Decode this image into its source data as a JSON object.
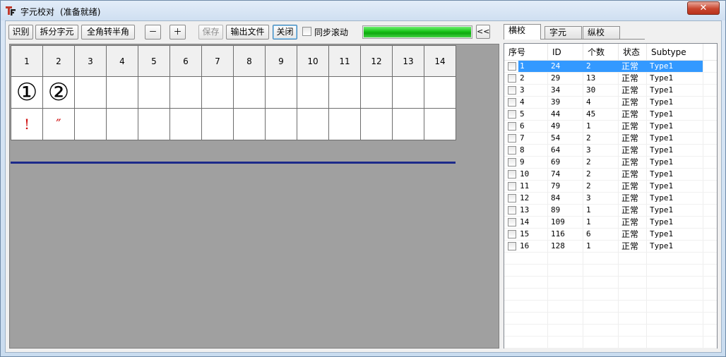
{
  "window": {
    "title": "字元校对",
    "status": "(准备就绪)",
    "close_label": "✕",
    "app_icon": "tf-logo-icon"
  },
  "toolbar": {
    "recognize": "识别",
    "split": "拆分字元",
    "fullwidth_to_halfwidth": "全角转半角",
    "zoom_out": "－",
    "zoom_in": "＋",
    "save": "保存",
    "export": "输出文件",
    "close": "关闭",
    "sync_scroll_label": "同步滚动",
    "sync_scroll_checked": false,
    "progress_percent": 100,
    "progress_color": "#17c217",
    "collapse": "<<"
  },
  "grid": {
    "columns": [
      "1",
      "2",
      "3",
      "4",
      "5",
      "6",
      "7",
      "8",
      "9",
      "10",
      "11",
      "12",
      "13",
      "14"
    ],
    "glyph_row": [
      "①",
      "②",
      "",
      "",
      "",
      "",
      "",
      "",
      "",
      "",
      "",
      "",
      "",
      ""
    ],
    "char_row": [
      "!",
      "″",
      "",
      "",
      "",
      "",
      "",
      "",
      "",
      "",
      "",
      "",
      "",
      ""
    ]
  },
  "tabs": [
    {
      "label": "横校",
      "active": true
    },
    {
      "label": "字元",
      "active": false
    },
    {
      "label": "纵校",
      "active": false
    }
  ],
  "list": {
    "headers": {
      "no": "序号",
      "id": "ID",
      "count": "个数",
      "status": "状态",
      "subtype": "Subtype"
    },
    "rows": [
      {
        "no": "1",
        "id": "24",
        "count": "2",
        "status": "正常",
        "subtype": "Type1",
        "selected": true
      },
      {
        "no": "2",
        "id": "29",
        "count": "13",
        "status": "正常",
        "subtype": "Type1"
      },
      {
        "no": "3",
        "id": "34",
        "count": "30",
        "status": "正常",
        "subtype": "Type1"
      },
      {
        "no": "4",
        "id": "39",
        "count": "4",
        "status": "正常",
        "subtype": "Type1"
      },
      {
        "no": "5",
        "id": "44",
        "count": "45",
        "status": "正常",
        "subtype": "Type1"
      },
      {
        "no": "6",
        "id": "49",
        "count": "1",
        "status": "正常",
        "subtype": "Type1"
      },
      {
        "no": "7",
        "id": "54",
        "count": "2",
        "status": "正常",
        "subtype": "Type1"
      },
      {
        "no": "8",
        "id": "64",
        "count": "3",
        "status": "正常",
        "subtype": "Type1"
      },
      {
        "no": "9",
        "id": "69",
        "count": "2",
        "status": "正常",
        "subtype": "Type1"
      },
      {
        "no": "10",
        "id": "74",
        "count": "2",
        "status": "正常",
        "subtype": "Type1"
      },
      {
        "no": "11",
        "id": "79",
        "count": "2",
        "status": "正常",
        "subtype": "Type1"
      },
      {
        "no": "12",
        "id": "84",
        "count": "3",
        "status": "正常",
        "subtype": "Type1"
      },
      {
        "no": "13",
        "id": "89",
        "count": "1",
        "status": "正常",
        "subtype": "Type1"
      },
      {
        "no": "14",
        "id": "109",
        "count": "1",
        "status": "正常",
        "subtype": "Type1"
      },
      {
        "no": "15",
        "id": "116",
        "count": "6",
        "status": "正常",
        "subtype": "Type1"
      },
      {
        "no": "16",
        "id": "128",
        "count": "1",
        "status": "正常",
        "subtype": "Type1"
      }
    ]
  }
}
